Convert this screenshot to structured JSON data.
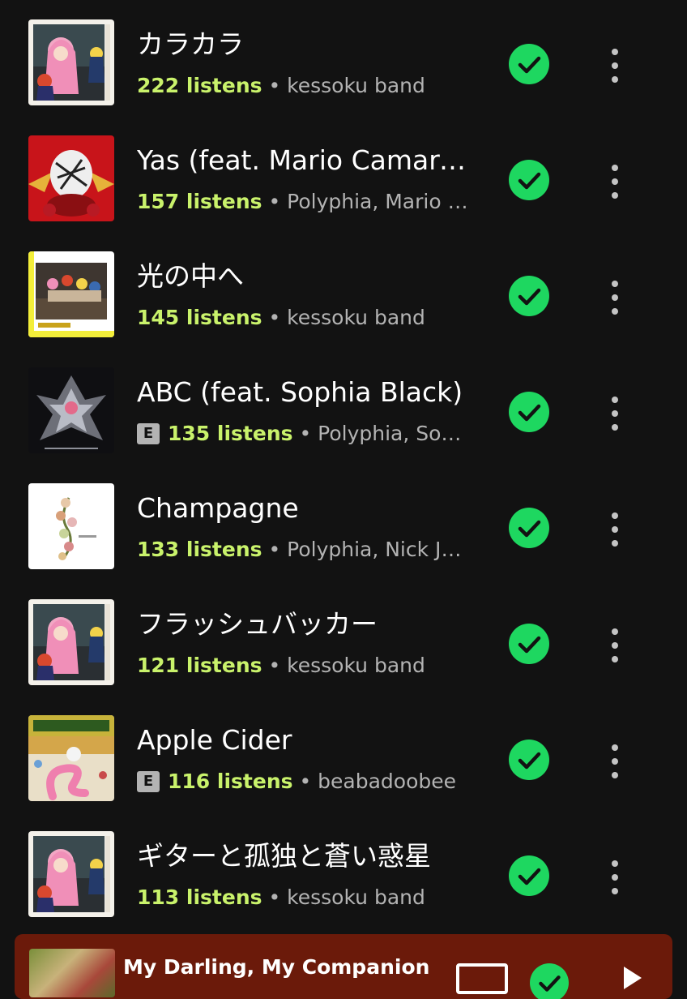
{
  "tracks": [
    {
      "title": "カラカラ",
      "listens": "222 listens",
      "separator": " • ",
      "artists": "kessoku band",
      "explicit": false,
      "art": "bocchi-green",
      "saved": true
    },
    {
      "title": "Yas (feat. Mario Camarena and Erick Hansel)",
      "listens": "157 listens",
      "separator": " • ",
      "artists": "Polyphia, Mario Camarena, Erick Hansel",
      "explicit": false,
      "art": "tiger-red",
      "saved": true
    },
    {
      "title": "光の中へ",
      "listens": "145 listens",
      "separator": " • ",
      "artists": "kessoku band",
      "explicit": false,
      "art": "bocchi-yellow",
      "saved": true
    },
    {
      "title": "ABC (feat. Sophia Black)",
      "listens": "135 listens",
      "separator": " • ",
      "artists": "Polyphia, Sophia Black",
      "explicit": true,
      "explicit_label": "E",
      "art": "chrome-dark",
      "saved": true
    },
    {
      "title": "Champagne",
      "listens": "133 listens",
      "separator": " • ",
      "artists": "Polyphia, Nick Johnston",
      "explicit": false,
      "art": "floral-white",
      "saved": true
    },
    {
      "title": "フラッシュバッカー",
      "listens": "121 listens",
      "separator": " • ",
      "artists": "kessoku band",
      "explicit": false,
      "art": "bocchi-green",
      "saved": true
    },
    {
      "title": "Apple Cider",
      "listens": "116 listens",
      "separator": " • ",
      "artists": "beabadoobee",
      "explicit": true,
      "explicit_label": "E",
      "art": "loveworm",
      "saved": true
    },
    {
      "title": "ギターと孤独と蒼い惑星",
      "listens": "113 listens",
      "separator": " • ",
      "artists": "kessoku band",
      "explicit": false,
      "art": "bocchi-green",
      "saved": true
    }
  ],
  "now_playing": {
    "title": "My Darling, My Companion",
    "device_icon": "connect-device-icon",
    "saved_icon": "check-icon",
    "play_icon": "play-icon"
  },
  "colors": {
    "background": "#121212",
    "listens_accent": "#c9f26b",
    "saved_green": "#1ed760",
    "secondary_text": "#b3b3b3",
    "player_bg": "#6b1a0a"
  }
}
